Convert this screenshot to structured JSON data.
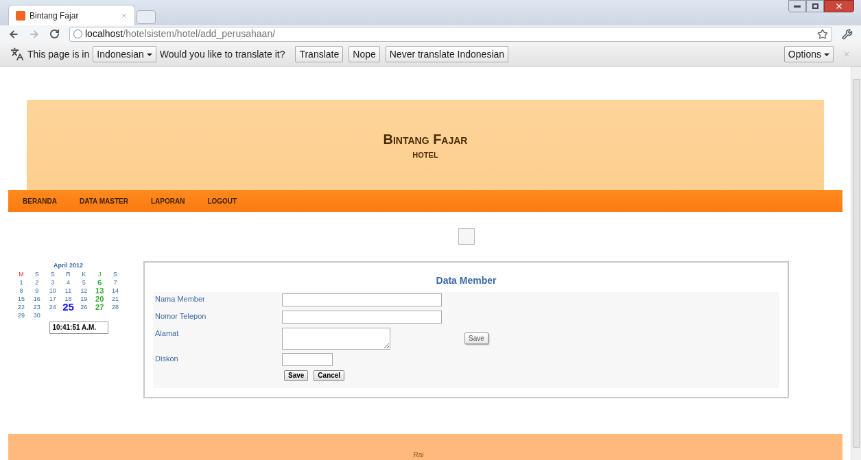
{
  "browser": {
    "tab_title": "Bintang Fajar",
    "url_host": "localhost",
    "url_path": "/hotelsistem/hotel/add_perusahaan/"
  },
  "translate_bar": {
    "prefix": "This page is in",
    "language": "Indonesian",
    "question": "Would you like to translate it?",
    "buttons": [
      "Translate",
      "Nope",
      "Never translate Indonesian"
    ],
    "options": "Options"
  },
  "header": {
    "title": "Bintang Fajar",
    "subtitle": "HOTEL"
  },
  "nav": [
    "BERANDA",
    "DATA MASTER",
    "LAPORAN",
    "LOGOUT"
  ],
  "calendar": {
    "month": "April 2012",
    "weekdays": [
      {
        "label": "M",
        "kind": "sunday"
      },
      {
        "label": "S",
        "kind": "normal"
      },
      {
        "label": "S",
        "kind": "normal"
      },
      {
        "label": "R",
        "kind": "normal"
      },
      {
        "label": "K",
        "kind": "normal"
      },
      {
        "label": "J",
        "kind": "friday"
      },
      {
        "label": "S",
        "kind": "normal"
      }
    ],
    "weeks": [
      [
        {
          "day": "1",
          "kind": "normal"
        },
        {
          "day": "2",
          "kind": "normal"
        },
        {
          "day": "3",
          "kind": "normal"
        },
        {
          "day": "4",
          "kind": "normal"
        },
        {
          "day": "5",
          "kind": "normal"
        },
        {
          "day": "6",
          "kind": "friday"
        },
        {
          "day": "7",
          "kind": "normal"
        }
      ],
      [
        {
          "day": "8",
          "kind": "normal"
        },
        {
          "day": "9",
          "kind": "normal"
        },
        {
          "day": "10",
          "kind": "normal"
        },
        {
          "day": "11",
          "kind": "normal"
        },
        {
          "day": "12",
          "kind": "normal"
        },
        {
          "day": "13",
          "kind": "friday"
        },
        {
          "day": "14",
          "kind": "normal"
        }
      ],
      [
        {
          "day": "15",
          "kind": "normal"
        },
        {
          "day": "16",
          "kind": "normal"
        },
        {
          "day": "17",
          "kind": "normal"
        },
        {
          "day": "18",
          "kind": "normal"
        },
        {
          "day": "19",
          "kind": "normal"
        },
        {
          "day": "20",
          "kind": "friday"
        },
        {
          "day": "21",
          "kind": "normal"
        }
      ],
      [
        {
          "day": "22",
          "kind": "normal"
        },
        {
          "day": "23",
          "kind": "normal"
        },
        {
          "day": "24",
          "kind": "normal"
        },
        {
          "day": "25",
          "kind": "today"
        },
        {
          "day": "26",
          "kind": "normal"
        },
        {
          "day": "27",
          "kind": "friday"
        },
        {
          "day": "28",
          "kind": "normal"
        }
      ],
      [
        {
          "day": "29",
          "kind": "normal"
        },
        {
          "day": "30",
          "kind": "normal"
        }
      ]
    ],
    "clock": "10:41:51 A.M."
  },
  "form": {
    "title": "Data Member",
    "fields": [
      {
        "label": "Nama Member",
        "kind": "text"
      },
      {
        "label": "Nomor Telepon",
        "kind": "text"
      },
      {
        "label": "Alamat",
        "kind": "textarea"
      },
      {
        "label": "Diskon",
        "kind": "short"
      }
    ],
    "side_button": "Save",
    "buttons": [
      "Save",
      "Cancel"
    ]
  },
  "footer": {
    "text": "Rai"
  }
}
